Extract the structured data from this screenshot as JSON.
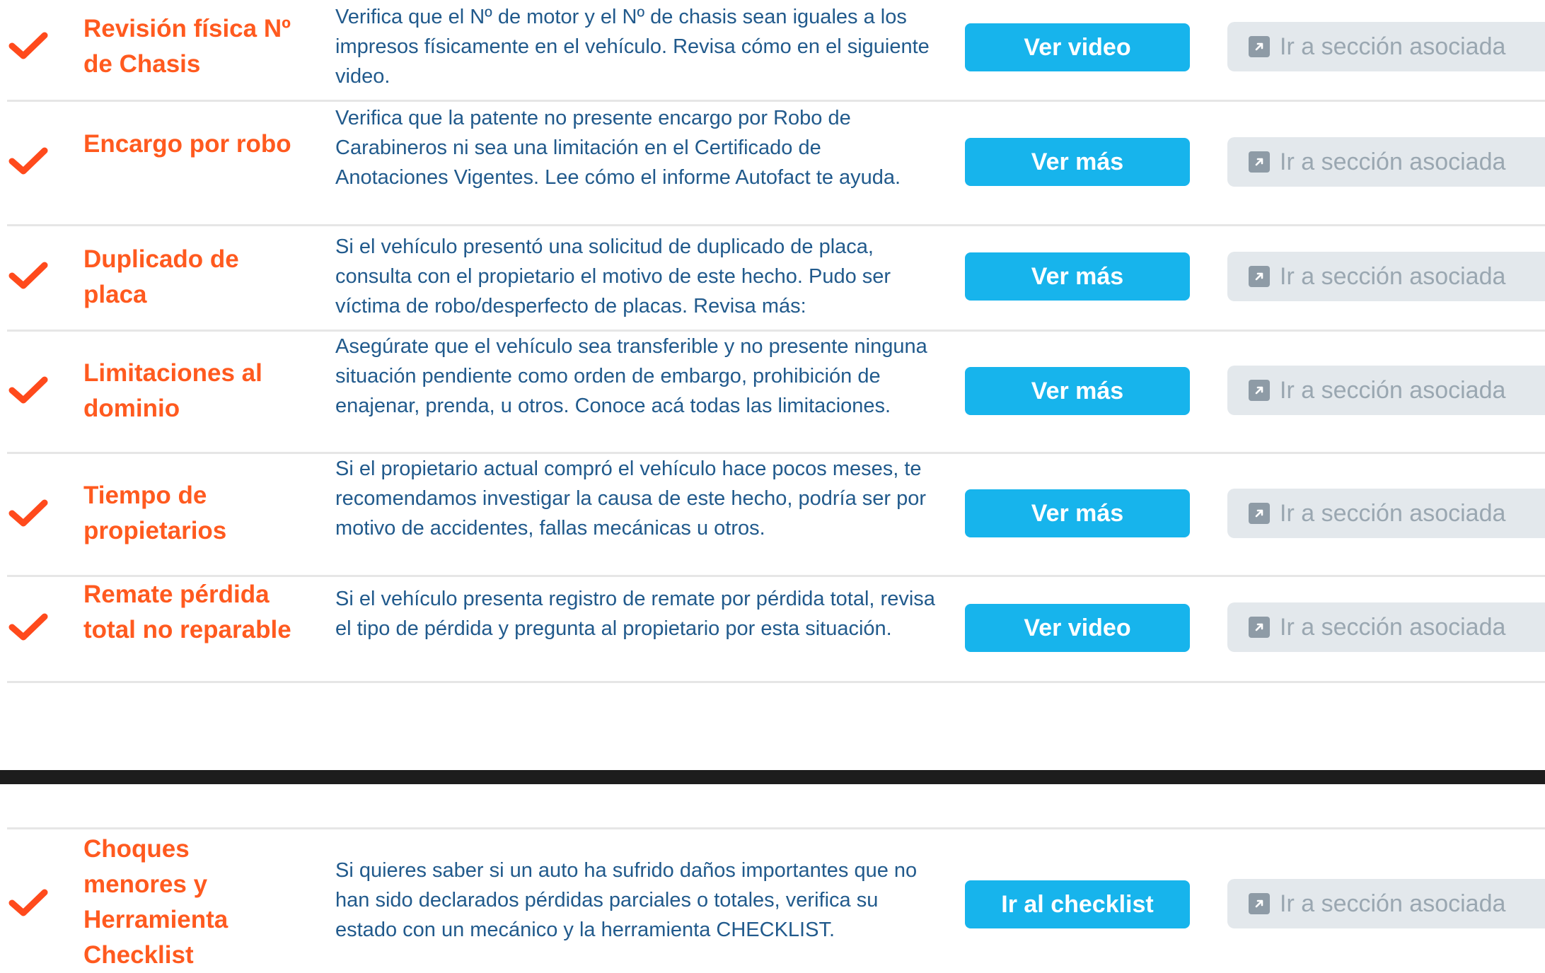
{
  "colors": {
    "accent_orange": "#ff5a1f",
    "description_blue": "#215a8c",
    "primary_button": "#17b4ec",
    "secondary_button_bg": "#e3e8ec",
    "secondary_button_text": "#9aa7b1",
    "divider": "#1d1d1d"
  },
  "icons": {
    "status": "checkmark-icon",
    "link": "external-link-icon"
  },
  "items": [
    {
      "title": "Revisión física Nº de Chasis",
      "description": "Verifica que el Nº de motor y el Nº de chasis sean iguales a los impresos físicamente en el vehículo. Revisa cómo en el siguiente video.",
      "action_label": "Ver video",
      "link_label": "Ir a sección asociada"
    },
    {
      "title": "Encargo por robo",
      "description": "Verifica que la patente no presente encargo por Robo de Carabineros ni sea una limitación en el Certificado de Anotaciones Vigentes. Lee cómo el informe Autofact te ayuda.",
      "action_label": "Ver más",
      "link_label": "Ir a sección asociada"
    },
    {
      "title": "Duplicado de placa",
      "description": "Si el vehículo presentó una solicitud de duplicado de placa, consulta con el propietario el motivo de este hecho. Pudo ser víctima de robo/desperfecto de placas. Revisa más:",
      "action_label": "Ver más",
      "link_label": "Ir a sección asociada"
    },
    {
      "title": "Limitaciones al dominio",
      "description": "Asegúrate que el vehículo sea transferible y no presente ninguna situación pendiente como orden de embargo, prohibición de enajenar, prenda, u otros. Conoce acá todas las limitaciones.",
      "action_label": "Ver más",
      "link_label": "Ir a sección asociada"
    },
    {
      "title": "Tiempo de propietarios",
      "description": "Si el propietario actual compró el vehículo hace pocos meses, te recomendamos investigar la causa de este hecho, podría ser por motivo de accidentes, fallas mecánicas u otros.",
      "action_label": "Ver más",
      "link_label": "Ir a sección asociada"
    },
    {
      "title": "Remate pérdida total no reparable",
      "description": "Si el vehículo presenta registro de remate por pérdida total, revisa el tipo de pérdida y pregunta al propietario por esta situación.",
      "action_label": "Ver video",
      "link_label": "Ir a sección asociada"
    }
  ],
  "bottom_item": {
    "title": "Choques menores y Herramienta Checklist",
    "description": "Si quieres saber si un auto ha sufrido daños importantes que no han sido declarados pérdidas parciales o totales, verifica su estado con un mecánico y la herramienta CHECKLIST.",
    "action_label": "Ir al checklist",
    "link_label": "Ir a sección asociada"
  }
}
